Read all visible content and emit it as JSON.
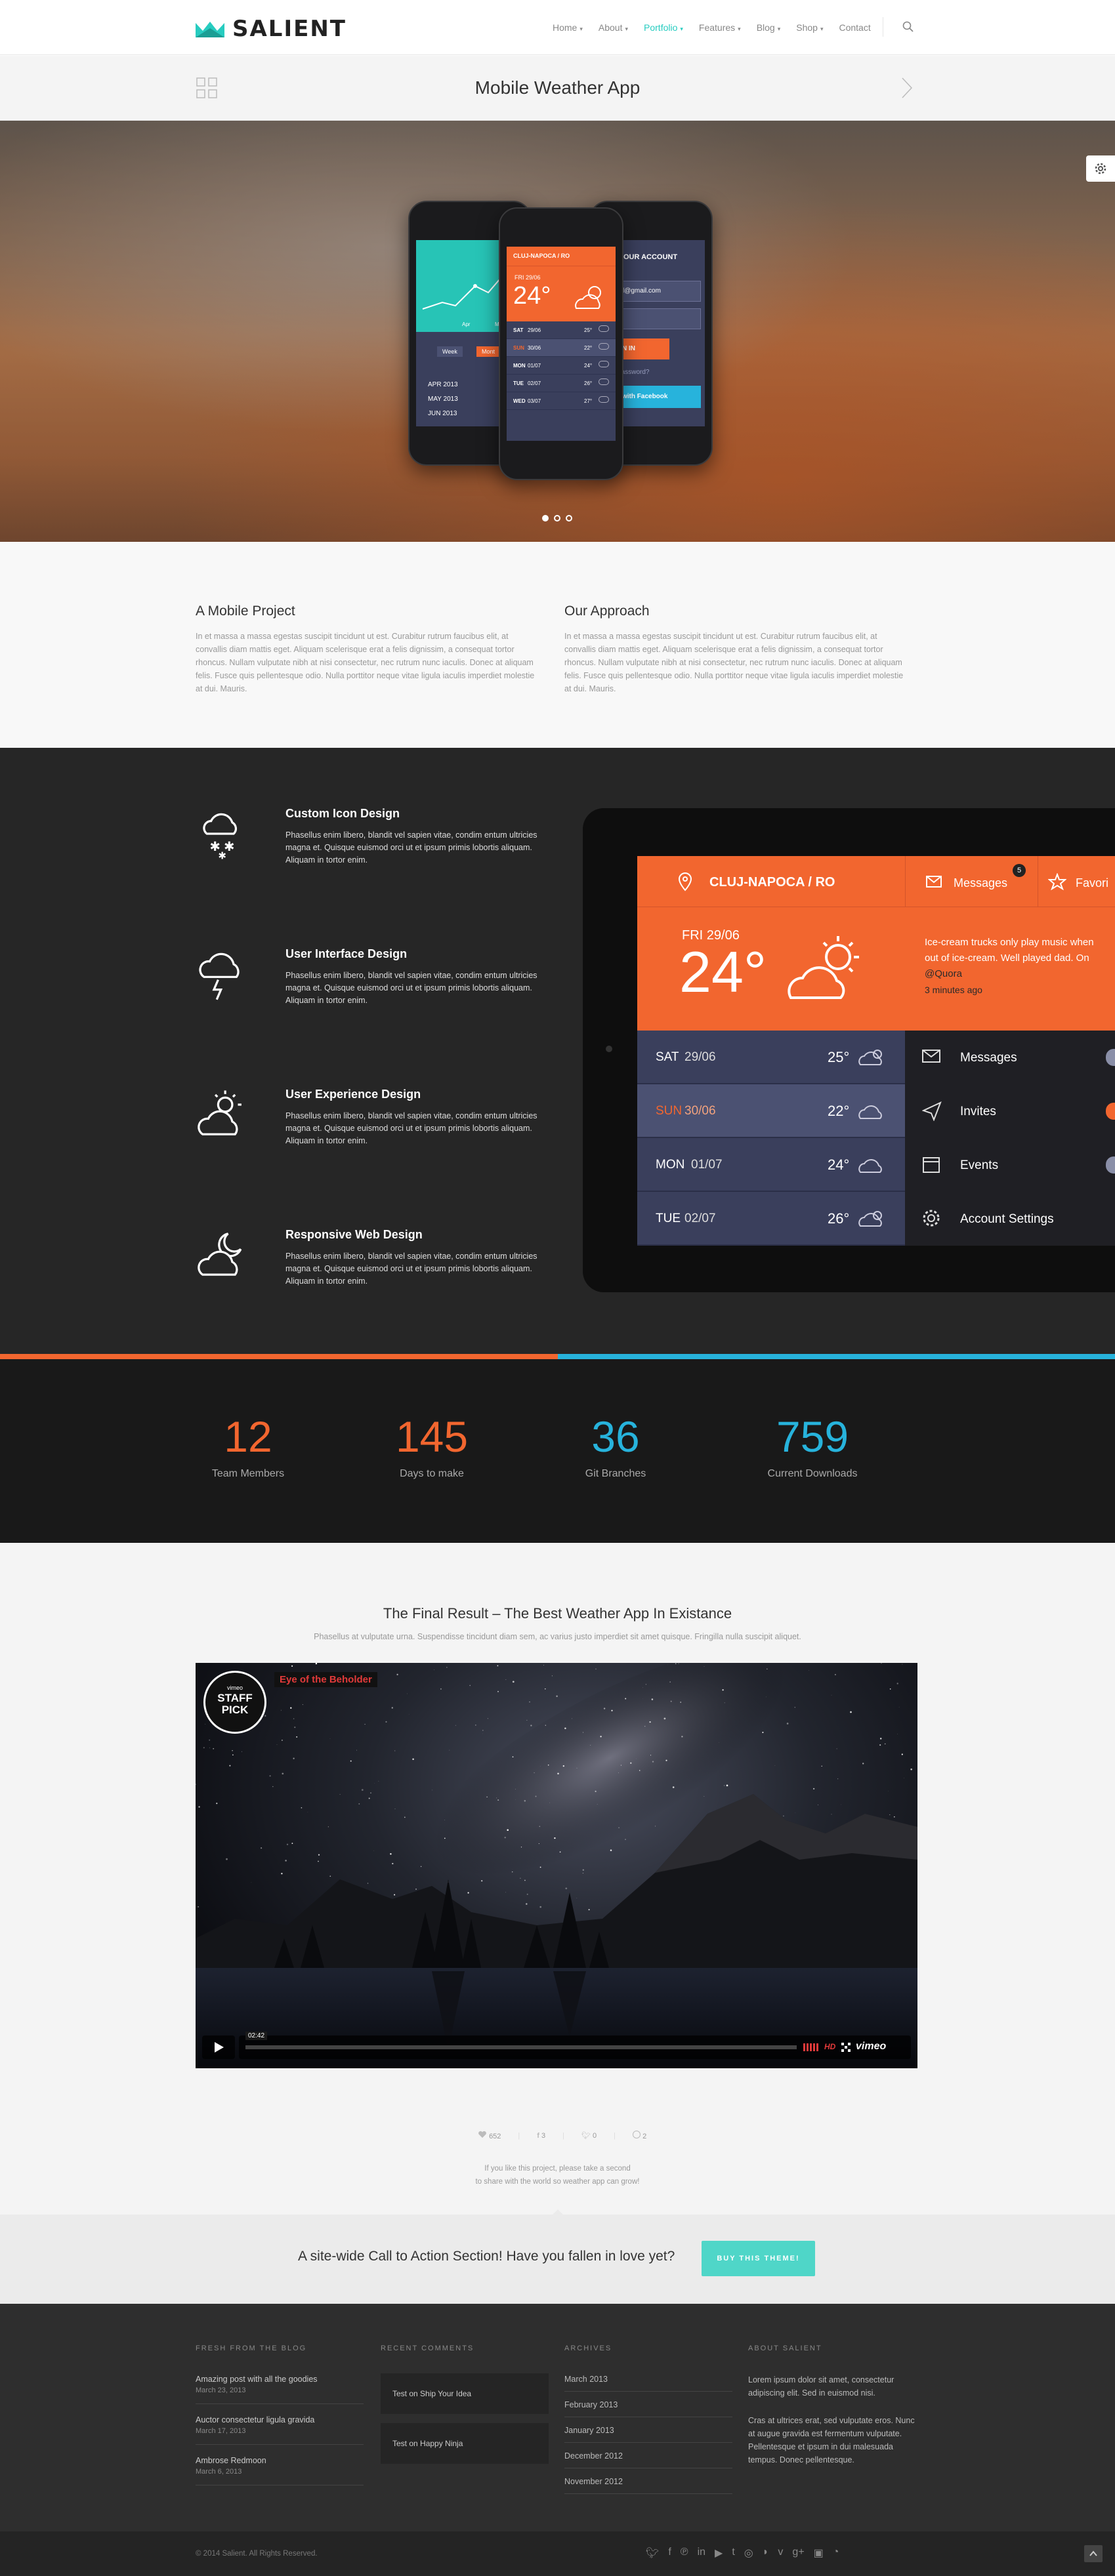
{
  "header": {
    "brand": "SALIENT",
    "nav": [
      {
        "label": "Home",
        "caret": true
      },
      {
        "label": "About",
        "caret": true
      },
      {
        "label": "Portfolio",
        "caret": true,
        "active": true
      },
      {
        "label": "Features",
        "caret": true
      },
      {
        "label": "Blog",
        "caret": true
      },
      {
        "label": "Shop",
        "caret": true
      },
      {
        "label": "Contact",
        "caret": false
      }
    ]
  },
  "project": {
    "title": "Mobile Weather App"
  },
  "hero": {
    "phone_left": {
      "months": [
        "APR 2013",
        "MAY 2013",
        "JUN 2013"
      ],
      "btn_week": "Week",
      "btn_month": "Mont",
      "chart_labels": [
        "Apr",
        "May"
      ]
    },
    "phone_center": {
      "city": "CLUJ-NAPOCA / RO",
      "day": "FRI 29/06",
      "temp": "24°",
      "days": [
        {
          "d": "SAT",
          "date": "29/06",
          "t": "25°"
        },
        {
          "d": "SUN",
          "date": "30/06",
          "t": "22°"
        },
        {
          "d": "MON",
          "date": "01/07",
          "t": "24°"
        },
        {
          "d": "TUE",
          "date": "02/07",
          "t": "26°"
        },
        {
          "d": "WED",
          "date": "03/07",
          "t": "27°"
        }
      ]
    },
    "phone_right": {
      "title": "OUR ACCOUNT",
      "email": "l@gmail.com",
      "signin": "N IN",
      "forgot": "Password?",
      "facebook": "with Facebook"
    },
    "slides": 3
  },
  "intro": {
    "left": {
      "title": "A Mobile Project",
      "text": "In et massa a massa egestas suscipit tincidunt ut est. Curabitur rutrum faucibus elit, at convallis diam mattis eget. Aliquam scelerisque erat a felis dignissim, a consequat tortor rhoncus. Nullam vulputate nibh at nisi consectetur, nec rutrum nunc iaculis. Donec at aliquam felis. Fusce quis pellentesque odio. Nulla porttitor neque vitae ligula iaculis imperdiet molestie at dui. Mauris."
    },
    "right": {
      "title": "Our Approach",
      "text": "In et massa a massa egestas suscipit tincidunt ut est. Curabitur rutrum faucibus elit, at convallis diam mattis eget. Aliquam scelerisque erat a felis dignissim, a consequat tortor rhoncus. Nullam vulputate nibh at nisi consectetur, nec rutrum nunc iaculis. Donec at aliquam felis. Fusce quis pellentesque odio. Nulla porttitor neque vitae ligula iaculis imperdiet molestie at dui. Mauris."
    }
  },
  "features": [
    {
      "icon": "cloud-snow-icon",
      "title": "Custom Icon Design",
      "text": "Phasellus enim libero, blandit vel sapien vitae, condim entum ultricies magna et. Quisque euismod orci ut et ipsum primis lobortis aliquam. Aliquam in tortor enim."
    },
    {
      "icon": "cloud-lightning-icon",
      "title": "User Interface Design",
      "text": "Phasellus enim libero, blandit vel sapien vitae, condim entum ultricies magna et. Quisque euismod orci ut et ipsum primis lobortis aliquam. Aliquam in tortor enim."
    },
    {
      "icon": "cloud-sun-icon",
      "title": "User Experience Design",
      "text": "Phasellus enim libero, blandit vel sapien vitae, condim entum ultricies magna et. Quisque euismod orci ut et ipsum primis lobortis aliquam. Aliquam in tortor enim."
    },
    {
      "icon": "cloud-moon-icon",
      "title": "Responsive Web Design",
      "text": "Phasellus enim libero, blandit vel sapien vitae, condim entum ultricies magna et. Quisque euismod orci ut et ipsum primis lobortis aliquam. Aliquam in tortor enim."
    }
  ],
  "tablet": {
    "city": "CLUJ-NAPOCA / RO",
    "messages": "Messages",
    "badge": "5",
    "favorites": "Favori",
    "day": "FRI 29/06",
    "temp": "24°",
    "tweet": "Ice-cream trucks only play music when out of ice-cream. Well played dad. On",
    "tweet_handle": "@Quora",
    "tweet_time": "3 minutes ago",
    "days": [
      {
        "d": "SAT",
        "date": "29/06",
        "t": "25°"
      },
      {
        "d": "SUN",
        "date": "30/06",
        "t": "22°"
      },
      {
        "d": "MON",
        "date": "01/07",
        "t": "24°"
      },
      {
        "d": "TUE",
        "date": "02/07",
        "t": "26°"
      }
    ],
    "menu": [
      "Messages",
      "Invites",
      "Events",
      "Account Settings"
    ]
  },
  "stats": [
    {
      "n": "12",
      "label": "Team Members",
      "color": "#f2662f"
    },
    {
      "n": "145",
      "label": "Days to make",
      "color": "#f2662f"
    },
    {
      "n": "36",
      "label": "Git Branches",
      "color": "#27b3dc"
    },
    {
      "n": "759",
      "label": "Current Downloads",
      "color": "#27b3dc"
    }
  ],
  "video": {
    "title": "The Final Result – The Best Weather App In Existance",
    "subtitle": "Phasellus at vulputate urna. Suspendisse tincidunt diam sem, ac varius justo imperdiet sit amet quisque. Fringilla nulla suscipit aliquet.",
    "clip_title": "Eye of the Beholder",
    "badge_top": "vimeo",
    "badge_main": "STAFF PICK",
    "time": "02:42",
    "hd": "HD",
    "brand": "vimeo"
  },
  "share": {
    "likes": "652",
    "fb": "3",
    "tw": "0",
    "pin": "2",
    "note_line1": "If you like this project, please take a second",
    "note_line2": "to share with the world so weather app can grow!"
  },
  "cta": {
    "text": "A site-wide Call to Action Section! Have you fallen in love yet?",
    "button": "BUY THIS THEME!"
  },
  "footer": {
    "blog_title": "FRESH FROM THE BLOG",
    "posts": [
      {
        "t": "Amazing post with all the goodies",
        "d": "March 23, 2013"
      },
      {
        "t": "Auctor consectetur ligula gravida",
        "d": "March 17, 2013"
      },
      {
        "t": "Ambrose Redmoon",
        "d": "March 6, 2013"
      }
    ],
    "comments_title": "RECENT COMMENTS",
    "comments": [
      "Test on Ship Your Idea",
      "Test on Happy Ninja"
    ],
    "archives_title": "ARCHIVES",
    "archives": [
      "March 2013",
      "February 2013",
      "January 2013",
      "December 2012",
      "November 2012"
    ],
    "about_title": "ABOUT SALIENT",
    "about_p1": "Lorem ipsum dolor sit amet, consectetur adipiscing elit. Sed in euismod nisi.",
    "about_p2": "Cras at ultrices erat, sed vulputate eros. Nunc at augue gravida est fermentum vulputate. Pellentesque et ipsum in dui malesuada tempus. Donec pellentesque.",
    "copyright": "© 2014 Salient. All Rights Reserved."
  },
  "colors": {
    "accent": "#27ccc0",
    "orange": "#f2662f",
    "blue": "#27b3dc",
    "navy": "#3a3f5c",
    "cta_button": "#4fd6c8"
  }
}
